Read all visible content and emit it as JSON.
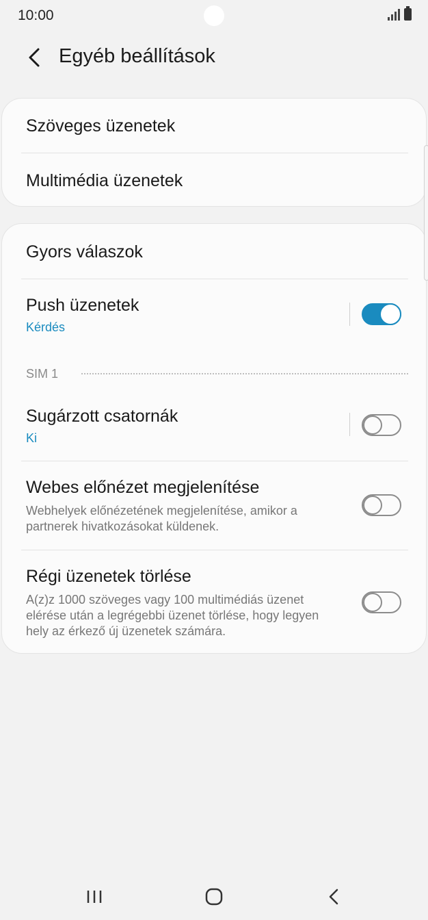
{
  "status_bar": {
    "time": "10:00"
  },
  "header": {
    "title": "Egyéb beállítások",
    "back_icon": "chevron-left-icon"
  },
  "card1": {
    "items": [
      {
        "title": "Szöveges üzenetek"
      },
      {
        "title": "Multimédia üzenetek"
      }
    ]
  },
  "card2": {
    "quick_replies": {
      "title": "Gyors válaszok"
    },
    "push": {
      "title": "Push üzenetek",
      "subtitle": "Kérdés",
      "enabled": true
    },
    "sim_label": "SIM 1",
    "broadcast": {
      "title": "Sugárzott csatornák",
      "subtitle": "Ki",
      "enabled": false
    },
    "web_preview": {
      "title": "Webes előnézet megjelenítése",
      "description": "Webhelyek előnézetének megjelenítése, amikor a partnerek hivatkozásokat küldenek.",
      "enabled": false
    },
    "delete_old": {
      "title": "Régi üzenetek törlése",
      "description": "A(z)z 1000 szöveges vagy 100 multimédiás üzenet elérése után a legrégebbi üzenet törlése, hogy legyen hely az érkező új üzenetek számára.",
      "enabled": false
    }
  },
  "colors": {
    "accent": "#1a8bbf",
    "background": "#f2f2f2",
    "card": "#fbfbfb"
  },
  "navbar": {
    "icons": [
      "recents-icon",
      "home-icon",
      "back-icon"
    ]
  }
}
